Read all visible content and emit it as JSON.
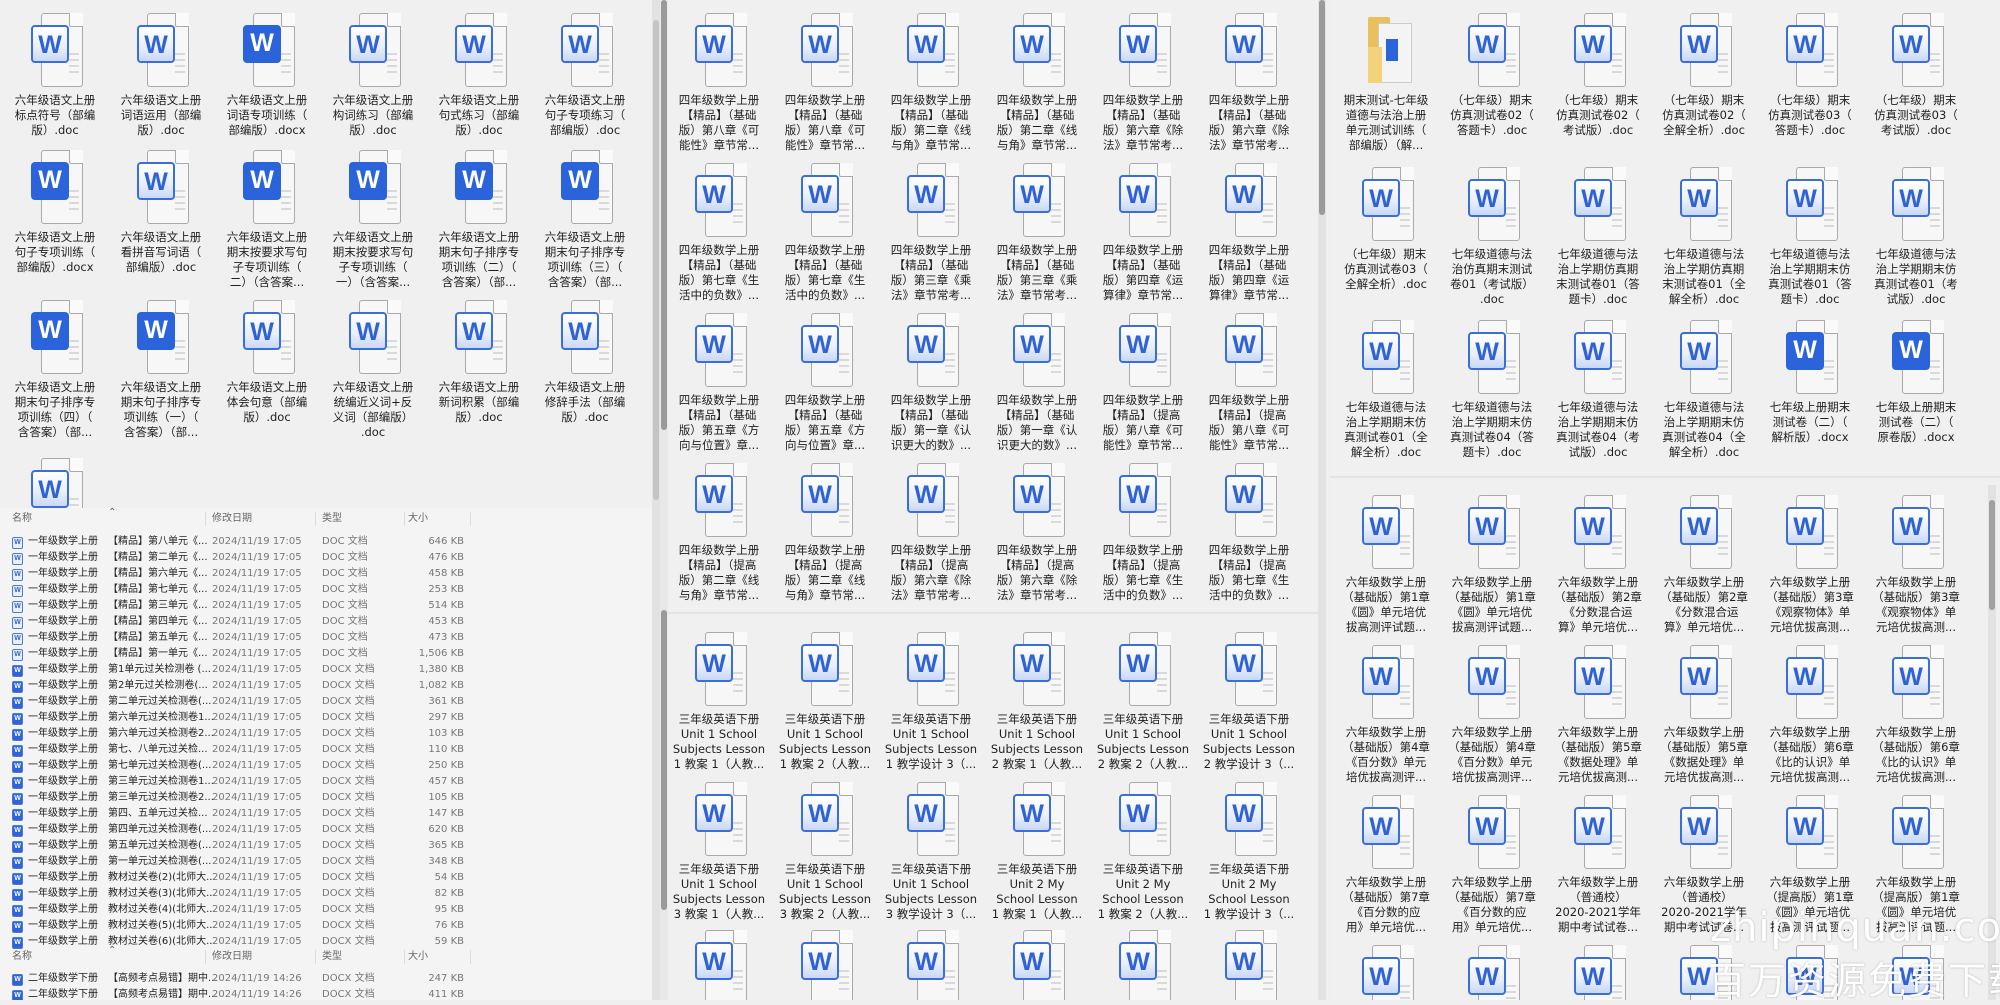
{
  "left_panel": {
    "grid": [
      [
        {
          "label": "六年级语文上册\n标点符号（部编\n版）.doc",
          "icon": "light"
        },
        {
          "label": "六年级语文上册\n词语运用（部编\n版）.doc",
          "icon": "light"
        },
        {
          "label": "六年级语文上册\n词语专项训练（\n部编版）.docx",
          "icon": "solid"
        },
        {
          "label": "六年级语文上册\n构词练习（部编\n版）.doc",
          "icon": "light"
        },
        {
          "label": "六年级语文上册\n句式练习（部编\n版）.doc",
          "icon": "light"
        },
        {
          "label": "六年级语文上册\n句子专项练习（\n部编版）.doc",
          "icon": "light"
        }
      ],
      [
        {
          "label": "六年级语文上册\n句子专项训练（\n部编版）.docx",
          "icon": "solid"
        },
        {
          "label": "六年级语文上册\n看拼音写词语（\n部编版）.doc",
          "icon": "light"
        },
        {
          "label": "六年级语文上册\n期末按要求写句\n子专项训练（\n二）（含答案...",
          "icon": "solid"
        },
        {
          "label": "六年级语文上册\n期末按要求写句\n子专项训练（\n一）（含答案...",
          "icon": "solid"
        },
        {
          "label": "六年级语文上册\n期末句子排序专\n项训练（二）（\n含答案）（部...",
          "icon": "solid"
        },
        {
          "label": "六年级语文上册\n期末句子排序专\n项训练（三）（\n含答案）（部...",
          "icon": "solid"
        }
      ],
      [
        {
          "label": "六年级语文上册\n期末句子排序专\n项训练（四）（\n含答案）（部...",
          "icon": "solid"
        },
        {
          "label": "六年级语文上册\n期末句子排序专\n项训练（一）（\n含答案）（部...",
          "icon": "solid"
        },
        {
          "label": "六年级语文上册\n体会句意（部编\n版）.doc",
          "icon": "light"
        },
        {
          "label": "六年级语文上册\n统编近义词+反\n义词（部编版）\n.doc",
          "icon": "light"
        },
        {
          "label": "六年级语文上册\n新词积累（部编\n版）.doc",
          "icon": "light"
        },
        {
          "label": "六年级语文上册\n修辞手法（部编\n版）.doc",
          "icon": "light"
        }
      ],
      [
        {
          "label": "",
          "icon": "light"
        }
      ]
    ],
    "list": {
      "headers": {
        "name": "名称",
        "date": "修改日期",
        "type": "类型",
        "size": "大小"
      },
      "rows": [
        {
          "n1": "一年级数学上册",
          "n2": "【精品】第八单元《...",
          "date": "2024/11/19 17:05",
          "type": "DOC 文档",
          "size": "646 KB",
          "kind": "doc"
        },
        {
          "n1": "一年级数学上册",
          "n2": "【精品】第二单元《...",
          "date": "2024/11/19 17:05",
          "type": "DOC 文档",
          "size": "476 KB",
          "kind": "doc"
        },
        {
          "n1": "一年级数学上册",
          "n2": "【精品】第六单元《...",
          "date": "2024/11/19 17:05",
          "type": "DOC 文档",
          "size": "458 KB",
          "kind": "doc"
        },
        {
          "n1": "一年级数学上册",
          "n2": "【精品】第七单元《...",
          "date": "2024/11/19 17:05",
          "type": "DOC 文档",
          "size": "253 KB",
          "kind": "doc"
        },
        {
          "n1": "一年级数学上册",
          "n2": "【精品】第三单元《...",
          "date": "2024/11/19 17:05",
          "type": "DOC 文档",
          "size": "514 KB",
          "kind": "doc"
        },
        {
          "n1": "一年级数学上册",
          "n2": "【精品】第四单元《...",
          "date": "2024/11/19 17:05",
          "type": "DOC 文档",
          "size": "453 KB",
          "kind": "doc"
        },
        {
          "n1": "一年级数学上册",
          "n2": "【精品】第五单元《...",
          "date": "2024/11/19 17:05",
          "type": "DOC 文档",
          "size": "473 KB",
          "kind": "doc"
        },
        {
          "n1": "一年级数学上册",
          "n2": "【精品】第一单元《...",
          "date": "2024/11/19 17:05",
          "type": "DOC 文档",
          "size": "1,506 KB",
          "kind": "doc"
        },
        {
          "n1": "一年级数学上册",
          "n2": "第1单元过关检测卷 (...",
          "date": "2024/11/19 17:05",
          "type": "DOCX 文档",
          "size": "1,380 KB",
          "kind": "docx"
        },
        {
          "n1": "一年级数学上册",
          "n2": "第2单元过关检测卷(...",
          "date": "2024/11/19 17:05",
          "type": "DOCX 文档",
          "size": "1,082 KB",
          "kind": "docx"
        },
        {
          "n1": "一年级数学上册",
          "n2": "第二单元过关检测卷(...",
          "date": "2024/11/19 17:05",
          "type": "DOCX 文档",
          "size": "361 KB",
          "kind": "docx"
        },
        {
          "n1": "一年级数学上册",
          "n2": "第六单元过关检测卷1...",
          "date": "2024/11/19 17:05",
          "type": "DOCX 文档",
          "size": "297 KB",
          "kind": "docx"
        },
        {
          "n1": "一年级数学上册",
          "n2": "第六单元过关检测卷2...",
          "date": "2024/11/19 17:05",
          "type": "DOCX 文档",
          "size": "103 KB",
          "kind": "docx"
        },
        {
          "n1": "一年级数学上册",
          "n2": "第七、八单元过关检...",
          "date": "2024/11/19 17:05",
          "type": "DOCX 文档",
          "size": "110 KB",
          "kind": "docx"
        },
        {
          "n1": "一年级数学上册",
          "n2": "第七单元过关检测卷(...",
          "date": "2024/11/19 17:05",
          "type": "DOCX 文档",
          "size": "250 KB",
          "kind": "docx"
        },
        {
          "n1": "一年级数学上册",
          "n2": "第三单元过关检测卷1...",
          "date": "2024/11/19 17:05",
          "type": "DOCX 文档",
          "size": "457 KB",
          "kind": "docx"
        },
        {
          "n1": "一年级数学上册",
          "n2": "第三单元过关检测卷2...",
          "date": "2024/11/19 17:05",
          "type": "DOCX 文档",
          "size": "105 KB",
          "kind": "docx"
        },
        {
          "n1": "一年级数学上册",
          "n2": "第四、五单元过关检...",
          "date": "2024/11/19 17:05",
          "type": "DOCX 文档",
          "size": "147 KB",
          "kind": "docx"
        },
        {
          "n1": "一年级数学上册",
          "n2": "第四单元过关检测卷(...",
          "date": "2024/11/19 17:05",
          "type": "DOCX 文档",
          "size": "620 KB",
          "kind": "docx"
        },
        {
          "n1": "一年级数学上册",
          "n2": "第五单元过关检测卷(...",
          "date": "2024/11/19 17:05",
          "type": "DOCX 文档",
          "size": "365 KB",
          "kind": "docx"
        },
        {
          "n1": "一年级数学上册",
          "n2": "第一单元过关检测卷(...",
          "date": "2024/11/19 17:05",
          "type": "DOCX 文档",
          "size": "348 KB",
          "kind": "docx"
        },
        {
          "n1": "一年级数学上册",
          "n2": "教材过关卷(2)(北师大...",
          "date": "2024/11/19 17:05",
          "type": "DOCX 文档",
          "size": "54 KB",
          "kind": "docx"
        },
        {
          "n1": "一年级数学上册",
          "n2": "教材过关卷(3)(北师大...",
          "date": "2024/11/19 17:05",
          "type": "DOCX 文档",
          "size": "82 KB",
          "kind": "docx"
        },
        {
          "n1": "一年级数学上册",
          "n2": "教材过关卷(4)(北师大...",
          "date": "2024/11/19 17:05",
          "type": "DOCX 文档",
          "size": "95 KB",
          "kind": "docx"
        },
        {
          "n1": "一年级数学上册",
          "n2": "教材过关卷(5)(北师大...",
          "date": "2024/11/19 17:05",
          "type": "DOCX 文档",
          "size": "76 KB",
          "kind": "docx"
        },
        {
          "n1": "一年级数学上册",
          "n2": "教材过关卷(6)(北师大...",
          "date": "2024/11/19 17:05",
          "type": "DOCX 文档",
          "size": "59 KB",
          "kind": "docx"
        }
      ]
    },
    "list2": {
      "headers": {
        "name": "名称",
        "date": "修改日期",
        "type": "类型",
        "size": "大小"
      },
      "rows": [
        {
          "n1": "二年级数学下册",
          "n2": "【高频考点易错】期中...",
          "date": "2024/11/19 14:26",
          "type": "DOCX 文档",
          "size": "247 KB",
          "kind": "docx"
        },
        {
          "n1": "二年级数学下册",
          "n2": "【高频考点易错】期中...",
          "date": "2024/11/19 14:26",
          "type": "DOCX 文档",
          "size": "411 KB",
          "kind": "docx"
        }
      ]
    }
  },
  "middle_panel": {
    "grid_top": [
      [
        {
          "label": "四年级数学上册\n【精品】（基础\n版）第八章《可\n能性》章节常...",
          "icon": "light"
        },
        {
          "label": "四年级数学上册\n【精品】（基础\n版）第八章《可\n能性》章节常...",
          "icon": "light"
        },
        {
          "label": "四年级数学上册\n【精品】（基础\n版）第二章《线\n与角》章节常...",
          "icon": "light"
        },
        {
          "label": "四年级数学上册\n【精品】（基础\n版）第二章《线\n与角》章节常...",
          "icon": "light"
        },
        {
          "label": "四年级数学上册\n【精品】（基础\n版）第六章《除\n法》章节常考...",
          "icon": "light"
        },
        {
          "label": "四年级数学上册\n【精品】（基础\n版）第六章《除\n法》章节常考...",
          "icon": "light"
        }
      ],
      [
        {
          "label": "四年级数学上册\n【精品】（基础\n版）第七章《生\n活中的负数》...",
          "icon": "light"
        },
        {
          "label": "四年级数学上册\n【精品】（基础\n版）第七章《生\n活中的负数》...",
          "icon": "light"
        },
        {
          "label": "四年级数学上册\n【精品】（基础\n版）第三章《乘\n法》章节常考...",
          "icon": "light"
        },
        {
          "label": "四年级数学上册\n【精品】（基础\n版）第三章《乘\n法》章节常考...",
          "icon": "light"
        },
        {
          "label": "四年级数学上册\n【精品】（基础\n版）第四章《运\n算律》章节常...",
          "icon": "light"
        },
        {
          "label": "四年级数学上册\n【精品】（基础\n版）第四章《运\n算律》章节常...",
          "icon": "light"
        }
      ],
      [
        {
          "label": "四年级数学上册\n【精品】（基础\n版）第五章《方\n向与位置》章...",
          "icon": "light"
        },
        {
          "label": "四年级数学上册\n【精品】（基础\n版）第五章《方\n向与位置》章...",
          "icon": "light"
        },
        {
          "label": "四年级数学上册\n【精品】（基础\n版）第一章《认\n识更大的数》...",
          "icon": "light"
        },
        {
          "label": "四年级数学上册\n【精品】（基础\n版）第一章《认\n识更大的数》...",
          "icon": "light"
        },
        {
          "label": "四年级数学上册\n【精品】（提高\n版）第八章《可\n能性》章节常...",
          "icon": "light"
        },
        {
          "label": "四年级数学上册\n【精品】（提高\n版）第八章《可\n能性》章节常...",
          "icon": "light"
        }
      ],
      [
        {
          "label": "四年级数学上册\n【精品】（提高\n版）第二章《线\n与角》章节常...",
          "icon": "light"
        },
        {
          "label": "四年级数学上册\n【精品】（提高\n版）第二章《线\n与角》章节常...",
          "icon": "light"
        },
        {
          "label": "四年级数学上册\n【精品】（提高\n版）第六章《除\n法》章节常考...",
          "icon": "light"
        },
        {
          "label": "四年级数学上册\n【精品】（提高\n版）第六章《除\n法》章节常考...",
          "icon": "light"
        },
        {
          "label": "四年级数学上册\n【精品】（提高\n版）第七章《生\n活中的负数》...",
          "icon": "light"
        },
        {
          "label": "四年级数学上册\n【精品】（提高\n版）第七章《生\n活中的负数》...",
          "icon": "light"
        }
      ]
    ],
    "grid_bottom": [
      [
        {
          "label": "三年级英语下册\nUnit 1 School\nSubjects Lesson\n1 教案 1（人教...",
          "icon": "light"
        },
        {
          "label": "三年级英语下册\nUnit 1 School\nSubjects Lesson\n1 教案 2（人教...",
          "icon": "light"
        },
        {
          "label": "三年级英语下册\nUnit 1 School\nSubjects Lesson\n1 教学设计 3（...",
          "icon": "light"
        },
        {
          "label": "三年级英语下册\nUnit 1 School\nSubjects Lesson\n2 教案 1（人教...",
          "icon": "light"
        },
        {
          "label": "三年级英语下册\nUnit 1 School\nSubjects Lesson\n2 教案 2（人教...",
          "icon": "light"
        },
        {
          "label": "三年级英语下册\nUnit 1 School\nSubjects Lesson\n2 教学设计 3（...",
          "icon": "light"
        }
      ],
      [
        {
          "label": "三年级英语下册\nUnit 1 School\nSubjects Lesson\n3 教案 1（人教...",
          "icon": "light"
        },
        {
          "label": "三年级英语下册\nUnit 1 School\nSubjects Lesson\n3 教案 2（人教...",
          "icon": "light"
        },
        {
          "label": "三年级英语下册\nUnit 1 School\nSubjects Lesson\n3 教学设计 3（...",
          "icon": "light"
        },
        {
          "label": "三年级英语下册\nUnit 2 My\nSchool Lesson\n1 教案 1（人教...",
          "icon": "light"
        },
        {
          "label": "三年级英语下册\nUnit 2 My\nSchool Lesson\n1 教案 2（人教...",
          "icon": "light"
        },
        {
          "label": "三年级英语下册\nUnit 2 My\nSchool Lesson\n1 教学设计 3（...",
          "icon": "light"
        }
      ],
      [
        {
          "label": "",
          "icon": "light"
        },
        {
          "label": "",
          "icon": "light"
        },
        {
          "label": "",
          "icon": "light"
        },
        {
          "label": "",
          "icon": "light"
        },
        {
          "label": "",
          "icon": "light"
        },
        {
          "label": "",
          "icon": "light"
        }
      ]
    ]
  },
  "right_panel": {
    "grid_top": [
      [
        {
          "label": "期末测试-七年级\n道德与法治上册\n单元测试训练（\n部编版）（解...",
          "icon": "folder"
        },
        {
          "label": "（七年级）期末\n仿真测试卷02（\n答题卡）.doc",
          "icon": "light"
        },
        {
          "label": "（七年级）期末\n仿真测试卷02（\n考试版）.doc",
          "icon": "light"
        },
        {
          "label": "（七年级）期末\n仿真测试卷02（\n全解全析）.doc",
          "icon": "light"
        },
        {
          "label": "（七年级）期末\n仿真测试卷03（\n答题卡）.doc",
          "icon": "light"
        },
        {
          "label": "（七年级）期末\n仿真测试卷03（\n考试版）.doc",
          "icon": "light"
        }
      ],
      [
        {
          "label": "（七年级）期末\n仿真测试卷03（\n全解全析）.doc",
          "icon": "light"
        },
        {
          "label": "七年级道德与法\n治仿真期末测试\n卷01（考试版）\n.doc",
          "icon": "light"
        },
        {
          "label": "七年级道德与法\n治上学期仿真期\n末测试卷01（答\n题卡）.doc",
          "icon": "light"
        },
        {
          "label": "七年级道德与法\n治上学期仿真期\n末测试卷01（全\n解全析）.doc",
          "icon": "light"
        },
        {
          "label": "七年级道德与法\n治上学期期末仿\n真测试卷01（答\n题卡）.doc",
          "icon": "light"
        },
        {
          "label": "七年级道德与法\n治上学期期末仿\n真测试卷01（考\n试版）.doc",
          "icon": "light"
        }
      ],
      [
        {
          "label": "七年级道德与法\n治上学期期末仿\n真测试卷01（全\n解全析）.doc",
          "icon": "light"
        },
        {
          "label": "七年级道德与法\n治上学期期末仿\n真测试卷04（答\n题卡）.doc",
          "icon": "light"
        },
        {
          "label": "七年级道德与法\n治上学期期末仿\n真测试卷04（考\n试版）.doc",
          "icon": "light"
        },
        {
          "label": "七年级道德与法\n治上学期期末仿\n真测试卷04（全\n解全析）.doc",
          "icon": "light"
        },
        {
          "label": "七年级上册期末\n测试卷（二）（\n解析版）.docx",
          "icon": "solid"
        },
        {
          "label": "七年级上册期末\n测试卷（二）（\n原卷版）.docx",
          "icon": "solid"
        }
      ]
    ],
    "grid_bottom": [
      [
        {
          "label": "六年级数学上册\n（基础版）第1章\n《圆》单元培优\n拔高测评试题...",
          "icon": "light"
        },
        {
          "label": "六年级数学上册\n（基础版）第1章\n《圆》单元培优\n拔高测评试题...",
          "icon": "light"
        },
        {
          "label": "六年级数学上册\n（基础版）第2章\n《分数混合运\n算》单元培优...",
          "icon": "light"
        },
        {
          "label": "六年级数学上册\n（基础版）第2章\n《分数混合运\n算》单元培优...",
          "icon": "light"
        },
        {
          "label": "六年级数学上册\n（基础版）第3章\n《观察物体》单\n元培优拔高测...",
          "icon": "light"
        },
        {
          "label": "六年级数学上册\n（基础版）第3章\n《观察物体》单\n元培优拔高测...",
          "icon": "light"
        }
      ],
      [
        {
          "label": "六年级数学上册\n（基础版）第4章\n《百分数》单元\n培优拔高测评...",
          "icon": "light"
        },
        {
          "label": "六年级数学上册\n（基础版）第4章\n《百分数》单元\n培优拔高测评...",
          "icon": "light"
        },
        {
          "label": "六年级数学上册\n（基础版）第5章\n《数据处理》单\n元培优拔高测...",
          "icon": "light"
        },
        {
          "label": "六年级数学上册\n（基础版）第5章\n《数据处理》单\n元培优拔高测...",
          "icon": "light"
        },
        {
          "label": "六年级数学上册\n（基础版）第6章\n《比的认识》单\n元培优拔高测...",
          "icon": "light"
        },
        {
          "label": "六年级数学上册\n（基础版）第6章\n《比的认识》单\n元培优拔高测...",
          "icon": "light"
        }
      ],
      [
        {
          "label": "六年级数学上册\n（基础版）第7章\n《百分数的应\n用》单元培优...",
          "icon": "light"
        },
        {
          "label": "六年级数学上册\n（基础版）第7章\n《百分数的应\n用》单元培优...",
          "icon": "light"
        },
        {
          "label": "六年级数学上册\n（普通校）\n2020-2021学年\n期中考试试卷...",
          "icon": "light"
        },
        {
          "label": "六年级数学上册\n（普通校）\n2020-2021学年\n期中考试试卷...",
          "icon": "light"
        },
        {
          "label": "六年级数学上册\n（提高版）第1章\n《圆》单元培优\n拔高测评试题...",
          "icon": "light"
        },
        {
          "label": "六年级数学上册\n（提高版）第1章\n《圆》单元培优\n拔高测评试题...",
          "icon": "light"
        }
      ],
      [
        {
          "label": "",
          "icon": "light"
        },
        {
          "label": "",
          "icon": "light"
        },
        {
          "label": "",
          "icon": "light"
        },
        {
          "label": "",
          "icon": "light"
        },
        {
          "label": "",
          "icon": "light"
        },
        {
          "label": "",
          "icon": "light"
        }
      ]
    ]
  },
  "watermark": {
    "line1": "zhipinquan.com",
    "line2": "百万资源免费下载"
  }
}
